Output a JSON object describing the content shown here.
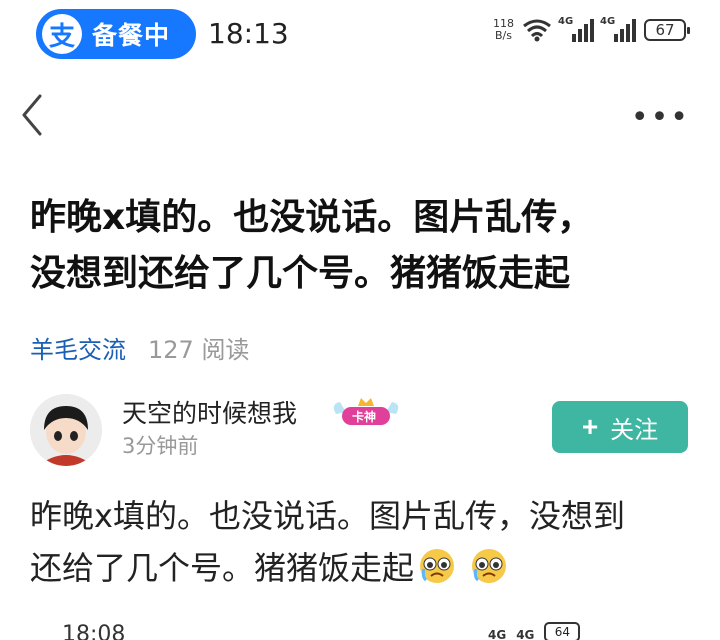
{
  "status_bar": {
    "app_pill_logo": "支",
    "app_pill_text": "备餐中",
    "time": "18:13",
    "net_speed_value": "118",
    "net_speed_unit": "B/s",
    "signal1_label": "4G",
    "signal2_label": "4G",
    "battery": "67"
  },
  "nav": {
    "back_icon": "chevron-left-icon",
    "more_icon": "more-dots-icon",
    "more_glyph": "•••"
  },
  "post": {
    "title_line1": "昨晚x填的。也没说话。图片乱传，",
    "title_line2": "没想到还给了几个号。猪猪饭走起",
    "category": "羊毛交流",
    "reads": "127 阅读",
    "author": {
      "name": "天空的时候想我",
      "badge": "卡神",
      "time": "3分钟前"
    },
    "follow_plus": "+",
    "follow_label": "关注",
    "body_line1": "昨晚x填的。也没说话。图片乱传，没想到",
    "body_line2": "还给了几个号。猪猪饭走起",
    "emoji_icon": "crying-face-icon"
  },
  "peek": {
    "time": "18:08",
    "sig1": "4G",
    "sig2": "4G",
    "battery": "64"
  },
  "colors": {
    "brand_blue": "#1677ff",
    "follow_green": "#3fb6a1",
    "category_blue": "#1a5fb4"
  }
}
